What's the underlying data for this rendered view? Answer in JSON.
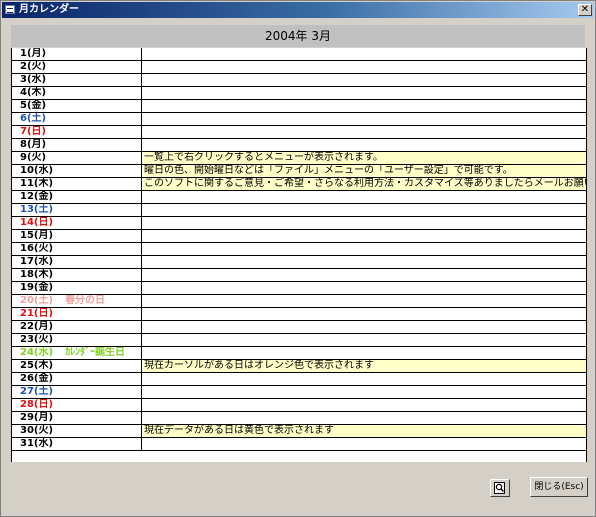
{
  "window": {
    "title": "月カレンダー",
    "close_glyph": "✕"
  },
  "header": {
    "month": "2004年 3月"
  },
  "days": [
    {
      "label": "1(月)",
      "color": "#000000",
      "note": ""
    },
    {
      "label": "2(火)",
      "color": "#000000",
      "note": ""
    },
    {
      "label": "3(水)",
      "color": "#000000",
      "note": ""
    },
    {
      "label": "4(木)",
      "color": "#000000",
      "note": ""
    },
    {
      "label": "5(金)",
      "color": "#000000",
      "note": ""
    },
    {
      "label": "6(土)",
      "color": "#2050b0",
      "note": ""
    },
    {
      "label": "7(日)",
      "color": "#e01010",
      "note": ""
    },
    {
      "label": "8(月)",
      "color": "#000000",
      "note": ""
    },
    {
      "label": "9(火)",
      "color": "#000000",
      "note": "一覧上で右クリックするとメニューが表示されます。"
    },
    {
      "label": "10(水)",
      "color": "#000000",
      "note": "曜日の色、開始曜日などは「ファイル」メニューの「ユーザー設定」で可能です。"
    },
    {
      "label": "11(木)",
      "color": "#000000",
      "note": "このソフトに関するご意見・ご希望・さらなる利用方法・カスタマイズ等ありましたらメールお願い"
    },
    {
      "label": "12(金)",
      "color": "#000000",
      "note": ""
    },
    {
      "label": "13(土)",
      "color": "#2050b0",
      "note": ""
    },
    {
      "label": "14(日)",
      "color": "#e01010",
      "note": ""
    },
    {
      "label": "15(月)",
      "color": "#000000",
      "note": ""
    },
    {
      "label": "16(火)",
      "color": "#000000",
      "note": ""
    },
    {
      "label": "17(水)",
      "color": "#000000",
      "note": ""
    },
    {
      "label": "18(木)",
      "color": "#000000",
      "note": ""
    },
    {
      "label": "19(金)",
      "color": "#000000",
      "note": ""
    },
    {
      "label": "20(土)",
      "color": "#f0a0a0",
      "holiday": "春分の日",
      "holiday_color": "#f0a0a0",
      "note": ""
    },
    {
      "label": "21(日)",
      "color": "#e01010",
      "note": ""
    },
    {
      "label": "22(月)",
      "color": "#000000",
      "note": ""
    },
    {
      "label": "23(火)",
      "color": "#000000",
      "note": ""
    },
    {
      "label": "24(水)",
      "color": "#80d020",
      "holiday": "ｶﾚﾝﾀﾞｰ誕生日",
      "holiday_color": "#80d020",
      "note": ""
    },
    {
      "label": "25(木)",
      "color": "#000000",
      "note": "現在カーソルがある日はオレンジ色で表示されます"
    },
    {
      "label": "26(金)",
      "color": "#000000",
      "note": ""
    },
    {
      "label": "27(土)",
      "color": "#2050b0",
      "note": ""
    },
    {
      "label": "28(日)",
      "color": "#e01010",
      "note": ""
    },
    {
      "label": "29(月)",
      "color": "#000000",
      "note": ""
    },
    {
      "label": "30(火)",
      "color": "#000000",
      "note": "現在データがある日は黄色で表示されます"
    },
    {
      "label": "31(水)",
      "color": "#000000",
      "note": ""
    }
  ],
  "buttons": {
    "preview_icon": "preview-icon",
    "close_label": "閉じる(Esc)"
  }
}
